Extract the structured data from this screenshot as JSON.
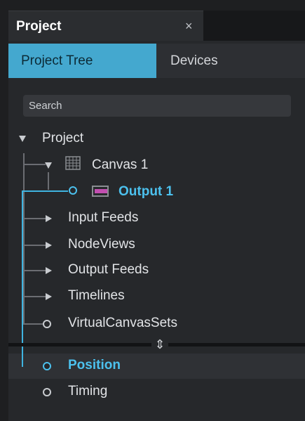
{
  "panel": {
    "title": "Project",
    "close_glyph": "×"
  },
  "tabs": [
    {
      "label": "Project Tree",
      "active": true
    },
    {
      "label": "Devices",
      "active": false
    }
  ],
  "search": {
    "placeholder": "Search",
    "value": ""
  },
  "tree": {
    "root": "Project",
    "canvas": "Canvas 1",
    "output": "Output 1",
    "input_feeds": "Input Feeds",
    "nodeviews": "NodeViews",
    "output_feeds": "Output Feeds",
    "timelines": "Timelines",
    "virtual_canvas_sets": "VirtualCanvasSets",
    "position": "Position",
    "timing": "Timing"
  },
  "colors": {
    "accent": "#44a8cf",
    "selection": "#4cc1ee",
    "output_icon": "#c24fb0"
  }
}
